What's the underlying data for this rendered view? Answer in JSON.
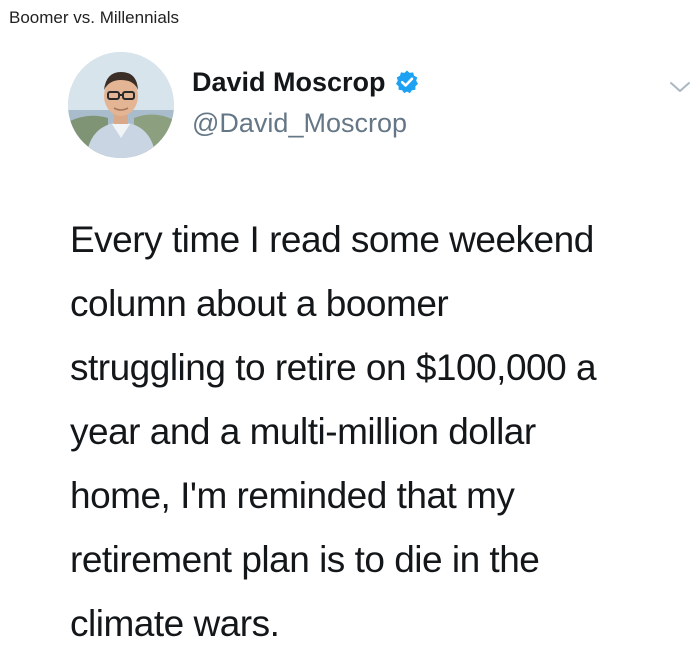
{
  "page": {
    "caption": "Boomer vs. Millennials"
  },
  "tweet": {
    "author": {
      "display_name": "David Moscrop",
      "handle": "@David_Moscrop",
      "verified": true,
      "avatar_icon": "profile-photo-avatar"
    },
    "menu_icon": "chevron-down-icon",
    "text_lines": [
      "Every time I read some weekend",
      "column about a boomer",
      "struggling to retire on $100,000 a",
      "year and a multi-million dollar",
      "home, I'm reminded that my",
      "retirement plan is to die in the",
      "climate wars."
    ]
  },
  "colors": {
    "verified_badge": "#1da1f2",
    "handle_text": "#657786",
    "body_text": "#14171a"
  }
}
